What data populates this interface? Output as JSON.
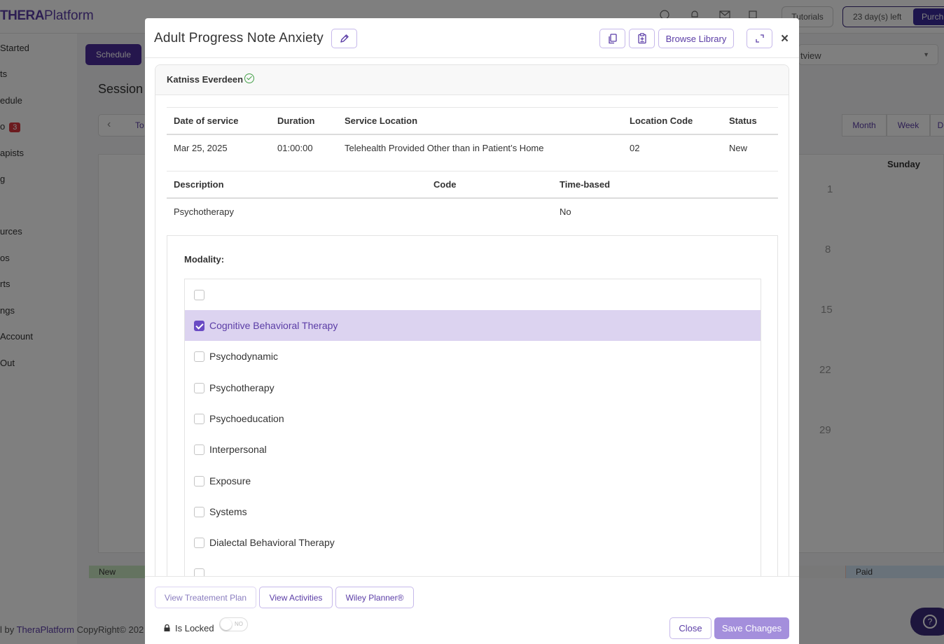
{
  "app": {
    "logo_bold": "THERA",
    "logo_rest": "Platform",
    "tutorials_label": "Tutorials",
    "trial_text": "23 day(s) left",
    "purchase_label": "Purch"
  },
  "sidebar": {
    "items": [
      {
        "label": "Started"
      },
      {
        "label": "ts"
      },
      {
        "label": "edule"
      },
      {
        "label": "o",
        "badge": "3"
      },
      {
        "label": "apists"
      },
      {
        "label": "g"
      },
      {
        "label": "urces"
      },
      {
        "label": "os"
      },
      {
        "label": "rts"
      },
      {
        "label": "ngs"
      },
      {
        "label": "Account"
      },
      {
        "label": " Out"
      }
    ]
  },
  "schedule": {
    "schedule_label": "Schedule",
    "sessions_title": "Session",
    "view_value": "tview",
    "today_label": "To",
    "seg_month": "Month",
    "seg_week": "Week",
    "seg_day": "D",
    "sunday_label": "Sunday",
    "days": [
      "1",
      "8",
      "15",
      "22",
      "29"
    ],
    "legend_new": "New",
    "legend_paid": "Paid"
  },
  "footer_bg": {
    "prefix": "l by ",
    "brand": "TheraPlatform",
    "suffix": " CopyRight© 202"
  },
  "modal": {
    "title": "Adult Progress Note Anxiety",
    "browse_library": "Browse Library",
    "close_x": "×",
    "client_name": "Katniss Everdeen",
    "service_headers": {
      "date": "Date of service",
      "duration": "Duration",
      "location": "Service Location",
      "location_code": "Location Code",
      "status": "Status"
    },
    "service_row": {
      "date": "Mar 25, 2025",
      "duration": "01:00:00",
      "location": "Telehealth Provided Other than in Patient’s Home",
      "location_code": "02",
      "status": "New"
    },
    "code_headers": {
      "description": "Description",
      "code": "Code",
      "time_based": "Time-based"
    },
    "code_row": {
      "description": "Psychotherapy",
      "code": "",
      "time_based": "No"
    },
    "modality_label": "Modality:",
    "modality_options": [
      {
        "label": "",
        "checked": false
      },
      {
        "label": "Cognitive Behavioral Therapy",
        "checked": true
      },
      {
        "label": "Psychodynamic",
        "checked": false
      },
      {
        "label": "Psychotherapy",
        "checked": false
      },
      {
        "label": "Psychoeducation",
        "checked": false
      },
      {
        "label": "Interpersonal",
        "checked": false
      },
      {
        "label": "Exposure",
        "checked": false
      },
      {
        "label": "Systems",
        "checked": false
      },
      {
        "label": "Dialectal Behavioral Therapy",
        "checked": false
      },
      {
        "label": "",
        "checked": false
      }
    ],
    "footer": {
      "view_treatment_plan": "View Treatement Plan",
      "view_activities": "View Activities",
      "wiley_planner": "Wiley Planner®",
      "is_locked": "Is Locked",
      "toggle_text": "NO",
      "close_label": "Close",
      "save_label": "Save Changes"
    }
  },
  "colors": {
    "accent": "#5b3da6",
    "selected_row": "#dcd3f0",
    "save_button": "#a48fdc",
    "badge": "#d9363e"
  }
}
